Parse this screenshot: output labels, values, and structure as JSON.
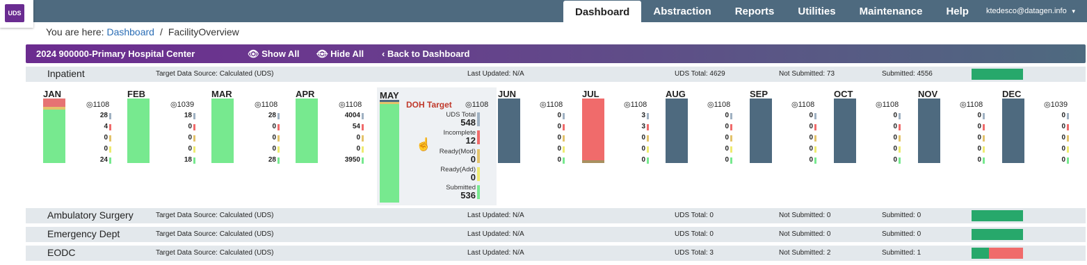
{
  "app": {
    "logo": "UDS",
    "user": "ktedesco@datagen.info",
    "nav": [
      "Dashboard",
      "Abstraction",
      "Reports",
      "Utilities",
      "Maintenance",
      "Help"
    ]
  },
  "crumb": {
    "prefix": "You are here:",
    "link": "Dashboard",
    "sep": "/",
    "current": "FacilityOverview"
  },
  "header": {
    "title": "2024 900000-Primary Hospital Center",
    "show_all": "Show All",
    "hide_all": "Hide All",
    "back": "Back to Dashboard"
  },
  "colors": {
    "submitted": "#77e98f",
    "incomplete": "#f06b6b",
    "mod": "#e3c36b",
    "add": "#eeea70",
    "uds": "#9fb1c2",
    "pending": "#4e6a7f",
    "bar_green": "#27a86b"
  },
  "sections": [
    {
      "name": "Inpatient",
      "source": "Target Data Source: Calculated (UDS)",
      "updated": "Last Updated: N/A",
      "total": "UDS Total: 4629",
      "not_submitted": "Not Submitted: 73",
      "submitted": "Submitted: 4556"
    },
    {
      "name": "Ambulatory Surgery",
      "source": "Target Data Source: Calculated (UDS)",
      "updated": "Last Updated: N/A",
      "total": "UDS Total: 0",
      "not_submitted": "Not Submitted: 0",
      "submitted": "Submitted: 0"
    },
    {
      "name": "Emergency Dept",
      "source": "Target Data Source: Calculated (UDS)",
      "updated": "Last Updated: N/A",
      "total": "UDS Total: 0",
      "not_submitted": "Not Submitted: 0",
      "submitted": "Submitted: 0"
    },
    {
      "name": "EODC",
      "source": "Target Data Source: Calculated (UDS)",
      "updated": "Last Updated: N/A",
      "total": "UDS Total: 3",
      "not_submitted": "Not Submitted: 2",
      "submitted": "Submitted: 1"
    }
  ],
  "months": [
    {
      "name": "JAN",
      "target": "◎1108",
      "vals": [
        "28",
        "4",
        "0",
        "0",
        "24"
      ]
    },
    {
      "name": "FEB",
      "target": "◎1039",
      "vals": [
        "18",
        "0",
        "0",
        "0",
        "18"
      ]
    },
    {
      "name": "MAR",
      "target": "◎1108",
      "vals": [
        "28",
        "0",
        "0",
        "0",
        "28"
      ]
    },
    {
      "name": "APR",
      "target": "◎1108",
      "vals": [
        "4004",
        "54",
        "0",
        "0",
        "3950"
      ]
    },
    {
      "name": "JUN",
      "target": "◎1108",
      "vals": [
        "0",
        "0",
        "0",
        "0",
        "0"
      ]
    },
    {
      "name": "JUL",
      "target": "◎1108",
      "vals": [
        "3",
        "3",
        "0",
        "0",
        "0"
      ]
    },
    {
      "name": "AUG",
      "target": "◎1108",
      "vals": [
        "0",
        "0",
        "0",
        "0",
        "0"
      ]
    },
    {
      "name": "SEP",
      "target": "◎1108",
      "vals": [
        "0",
        "0",
        "0",
        "0",
        "0"
      ]
    },
    {
      "name": "OCT",
      "target": "◎1108",
      "vals": [
        "0",
        "0",
        "0",
        "0",
        "0"
      ]
    },
    {
      "name": "NOV",
      "target": "◎1108",
      "vals": [
        "0",
        "0",
        "0",
        "0",
        "0"
      ]
    },
    {
      "name": "DEC",
      "target": "◎1039",
      "vals": [
        "0",
        "0",
        "0",
        "0",
        "0"
      ]
    }
  ],
  "may": {
    "name": "MAY",
    "doh": "DOH Target",
    "target": "◎1108",
    "rows": [
      {
        "label": "UDS Total",
        "value": "548"
      },
      {
        "label": "Incomplete",
        "value": "12"
      },
      {
        "label": "Ready(Mod)",
        "value": "0"
      },
      {
        "label": "Ready(Add)",
        "value": "0"
      },
      {
        "label": "Submitted",
        "value": "536"
      }
    ]
  }
}
